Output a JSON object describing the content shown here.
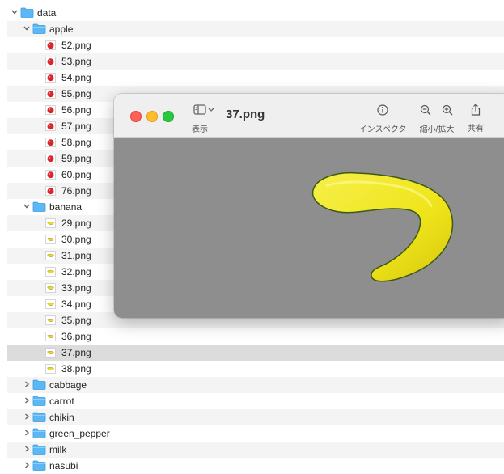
{
  "tree": {
    "root": "data",
    "apple": {
      "name": "apple",
      "files": [
        "52.png",
        "53.png",
        "54.png",
        "55.png",
        "56.png",
        "57.png",
        "58.png",
        "59.png",
        "60.png",
        "76.png"
      ]
    },
    "banana": {
      "name": "banana",
      "files": [
        "29.png",
        "30.png",
        "31.png",
        "32.png",
        "33.png",
        "34.png",
        "35.png",
        "36.png",
        "37.png",
        "38.png"
      ],
      "selected": "37.png"
    },
    "collapsed": [
      "cabbage",
      "carrot",
      "chikin",
      "green_pepper",
      "milk",
      "nasubi"
    ]
  },
  "preview": {
    "title": "37.png",
    "sidebar_label": "表示",
    "inspector_label": "インスペクタ",
    "zoom_label": "縮小/拡大",
    "share_label": "共有"
  },
  "colors": {
    "folder_blue": "#5bb8f5",
    "close": "#fe5f57",
    "minimize": "#febc2e",
    "zoom": "#28c840",
    "canvas_bg": "#8e8e8e",
    "banana_yellow": "#f1ea1f"
  }
}
